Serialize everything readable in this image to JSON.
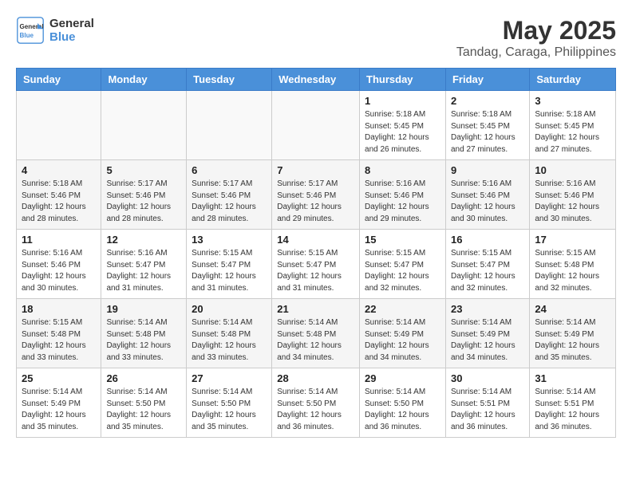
{
  "header": {
    "logo_line1": "General",
    "logo_line2": "Blue",
    "month": "May 2025",
    "location": "Tandag, Caraga, Philippines"
  },
  "weekdays": [
    "Sunday",
    "Monday",
    "Tuesday",
    "Wednesday",
    "Thursday",
    "Friday",
    "Saturday"
  ],
  "weeks": [
    [
      {
        "day": "",
        "empty": true
      },
      {
        "day": "",
        "empty": true
      },
      {
        "day": "",
        "empty": true
      },
      {
        "day": "",
        "empty": true
      },
      {
        "day": "1",
        "sunrise": "5:18 AM",
        "sunset": "5:45 PM",
        "daylight": "12 hours and 26 minutes."
      },
      {
        "day": "2",
        "sunrise": "5:18 AM",
        "sunset": "5:45 PM",
        "daylight": "12 hours and 27 minutes."
      },
      {
        "day": "3",
        "sunrise": "5:18 AM",
        "sunset": "5:45 PM",
        "daylight": "12 hours and 27 minutes."
      }
    ],
    [
      {
        "day": "4",
        "sunrise": "5:18 AM",
        "sunset": "5:46 PM",
        "daylight": "12 hours and 28 minutes."
      },
      {
        "day": "5",
        "sunrise": "5:17 AM",
        "sunset": "5:46 PM",
        "daylight": "12 hours and 28 minutes."
      },
      {
        "day": "6",
        "sunrise": "5:17 AM",
        "sunset": "5:46 PM",
        "daylight": "12 hours and 28 minutes."
      },
      {
        "day": "7",
        "sunrise": "5:17 AM",
        "sunset": "5:46 PM",
        "daylight": "12 hours and 29 minutes."
      },
      {
        "day": "8",
        "sunrise": "5:16 AM",
        "sunset": "5:46 PM",
        "daylight": "12 hours and 29 minutes."
      },
      {
        "day": "9",
        "sunrise": "5:16 AM",
        "sunset": "5:46 PM",
        "daylight": "12 hours and 30 minutes."
      },
      {
        "day": "10",
        "sunrise": "5:16 AM",
        "sunset": "5:46 PM",
        "daylight": "12 hours and 30 minutes."
      }
    ],
    [
      {
        "day": "11",
        "sunrise": "5:16 AM",
        "sunset": "5:46 PM",
        "daylight": "12 hours and 30 minutes."
      },
      {
        "day": "12",
        "sunrise": "5:16 AM",
        "sunset": "5:47 PM",
        "daylight": "12 hours and 31 minutes."
      },
      {
        "day": "13",
        "sunrise": "5:15 AM",
        "sunset": "5:47 PM",
        "daylight": "12 hours and 31 minutes."
      },
      {
        "day": "14",
        "sunrise": "5:15 AM",
        "sunset": "5:47 PM",
        "daylight": "12 hours and 31 minutes."
      },
      {
        "day": "15",
        "sunrise": "5:15 AM",
        "sunset": "5:47 PM",
        "daylight": "12 hours and 32 minutes."
      },
      {
        "day": "16",
        "sunrise": "5:15 AM",
        "sunset": "5:47 PM",
        "daylight": "12 hours and 32 minutes."
      },
      {
        "day": "17",
        "sunrise": "5:15 AM",
        "sunset": "5:48 PM",
        "daylight": "12 hours and 32 minutes."
      }
    ],
    [
      {
        "day": "18",
        "sunrise": "5:15 AM",
        "sunset": "5:48 PM",
        "daylight": "12 hours and 33 minutes."
      },
      {
        "day": "19",
        "sunrise": "5:14 AM",
        "sunset": "5:48 PM",
        "daylight": "12 hours and 33 minutes."
      },
      {
        "day": "20",
        "sunrise": "5:14 AM",
        "sunset": "5:48 PM",
        "daylight": "12 hours and 33 minutes."
      },
      {
        "day": "21",
        "sunrise": "5:14 AM",
        "sunset": "5:48 PM",
        "daylight": "12 hours and 34 minutes."
      },
      {
        "day": "22",
        "sunrise": "5:14 AM",
        "sunset": "5:49 PM",
        "daylight": "12 hours and 34 minutes."
      },
      {
        "day": "23",
        "sunrise": "5:14 AM",
        "sunset": "5:49 PM",
        "daylight": "12 hours and 34 minutes."
      },
      {
        "day": "24",
        "sunrise": "5:14 AM",
        "sunset": "5:49 PM",
        "daylight": "12 hours and 35 minutes."
      }
    ],
    [
      {
        "day": "25",
        "sunrise": "5:14 AM",
        "sunset": "5:49 PM",
        "daylight": "12 hours and 35 minutes."
      },
      {
        "day": "26",
        "sunrise": "5:14 AM",
        "sunset": "5:50 PM",
        "daylight": "12 hours and 35 minutes."
      },
      {
        "day": "27",
        "sunrise": "5:14 AM",
        "sunset": "5:50 PM",
        "daylight": "12 hours and 35 minutes."
      },
      {
        "day": "28",
        "sunrise": "5:14 AM",
        "sunset": "5:50 PM",
        "daylight": "12 hours and 36 minutes."
      },
      {
        "day": "29",
        "sunrise": "5:14 AM",
        "sunset": "5:50 PM",
        "daylight": "12 hours and 36 minutes."
      },
      {
        "day": "30",
        "sunrise": "5:14 AM",
        "sunset": "5:51 PM",
        "daylight": "12 hours and 36 minutes."
      },
      {
        "day": "31",
        "sunrise": "5:14 AM",
        "sunset": "5:51 PM",
        "daylight": "12 hours and 36 minutes."
      }
    ]
  ]
}
